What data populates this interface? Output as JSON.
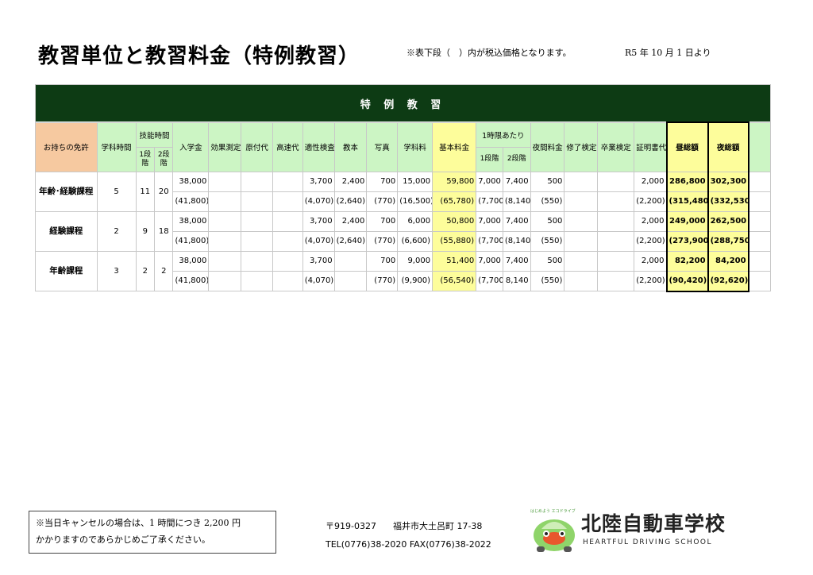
{
  "header": {
    "title": "教習単位と教習料金（特例教習）",
    "note": "※表下段（　）内が税込価格となります。",
    "effective_date": "R5 年 10 月 1 日より"
  },
  "chart_data": {
    "type": "table",
    "banner": "特 例 教 習",
    "headers": {
      "license": "お持ちの免許",
      "academic_hours": "学科時間",
      "skill_hours": "技能時間",
      "stage1": "1段階",
      "stage2": "2段階",
      "enrollment": "入学金",
      "effect_measure": "効果測定",
      "origin_fee": "原付代",
      "highway": "高速代",
      "aptitude": "適性検査",
      "textbook": "教本",
      "photo": "写真",
      "academic_fee": "学科料",
      "basic_fee": "基本料金",
      "hourly": "1時限あたり",
      "night_fee": "夜間料金",
      "completion": "修了検定",
      "graduation": "卒業検定",
      "certificate": "証明書代",
      "day_total": "昼総額",
      "night_total": "夜総額"
    },
    "rows": [
      {
        "course": "年齢･経験課程",
        "academic_hours": "5",
        "stage1": "11",
        "stage2": "20",
        "enrollment": [
          "38,000",
          "(41,800)"
        ],
        "aptitude": [
          "3,700",
          "(4,070)"
        ],
        "textbook": [
          "2,400",
          "(2,640)"
        ],
        "photo": [
          "700",
          "(770)"
        ],
        "academic_fee": [
          "15,000",
          "(16,500)"
        ],
        "basic_fee": [
          "59,800",
          "(65,780)"
        ],
        "hourly_s1": [
          "7,000",
          "(7,700)"
        ],
        "hourly_s2": [
          "7,400",
          "(8,140)"
        ],
        "night_fee": [
          "500",
          "(550)"
        ],
        "certificate": [
          "2,000",
          "(2,200)"
        ],
        "day_total": [
          "286,800",
          "(315,480)"
        ],
        "night_total": [
          "302,300",
          "(332,530)"
        ]
      },
      {
        "course": "経験課程",
        "academic_hours": "2",
        "stage1": "9",
        "stage2": "18",
        "enrollment": [
          "38,000",
          "(41,800)"
        ],
        "aptitude": [
          "3,700",
          "(4,070)"
        ],
        "textbook": [
          "2,400",
          "(2,640)"
        ],
        "photo": [
          "700",
          "(770)"
        ],
        "academic_fee": [
          "6,000",
          "(6,600)"
        ],
        "basic_fee": [
          "50,800",
          "(55,880)"
        ],
        "hourly_s1": [
          "7,000",
          "(7,700)"
        ],
        "hourly_s2": [
          "7,400",
          "(8,140)"
        ],
        "night_fee": [
          "500",
          "(550)"
        ],
        "certificate": [
          "2,000",
          "(2,200)"
        ],
        "day_total": [
          "249,000",
          "(273,900)"
        ],
        "night_total": [
          "262,500",
          "(288,750)"
        ]
      },
      {
        "course": "年齢課程",
        "academic_hours": "3",
        "stage1": "2",
        "stage2": "2",
        "enrollment": [
          "38,000",
          "(41,800)"
        ],
        "aptitude": [
          "3,700",
          "(4,070)"
        ],
        "textbook": [
          "",
          ""
        ],
        "photo": [
          "700",
          "(770)"
        ],
        "academic_fee": [
          "9,000",
          "(9,900)"
        ],
        "basic_fee": [
          "51,400",
          "(56,540)"
        ],
        "hourly_s1": [
          "7,000",
          "(7,700)"
        ],
        "hourly_s2": [
          "7,400",
          "8,140"
        ],
        "night_fee": [
          "500",
          "(550)"
        ],
        "certificate": [
          "2,000",
          "(2,200)"
        ],
        "day_total": [
          "82,200",
          "(90,420)"
        ],
        "night_total": [
          "84,200",
          "(92,620)"
        ]
      }
    ]
  },
  "footer": {
    "cancel_line1": "※当日キャンセルの場合は、1 時間につき 2,200 円",
    "cancel_line2": "かかりますのであらかじめご了承ください。",
    "postal": "〒919-0327",
    "address": "福井市大土呂町 17-38",
    "phone": "TEL(0776)38-2020 FAX(0776)38-2022",
    "logo_small": "はじめよう エコドライブ",
    "logo_name": "北陸自動車学校",
    "logo_sub": "HEARTFUL DRIVING SCHOOL",
    "colors": {
      "banner": "#0d3b14",
      "header": "#ccf5c4",
      "license_header": "#f6c9a0",
      "highlight": "#fdfd9b"
    }
  }
}
